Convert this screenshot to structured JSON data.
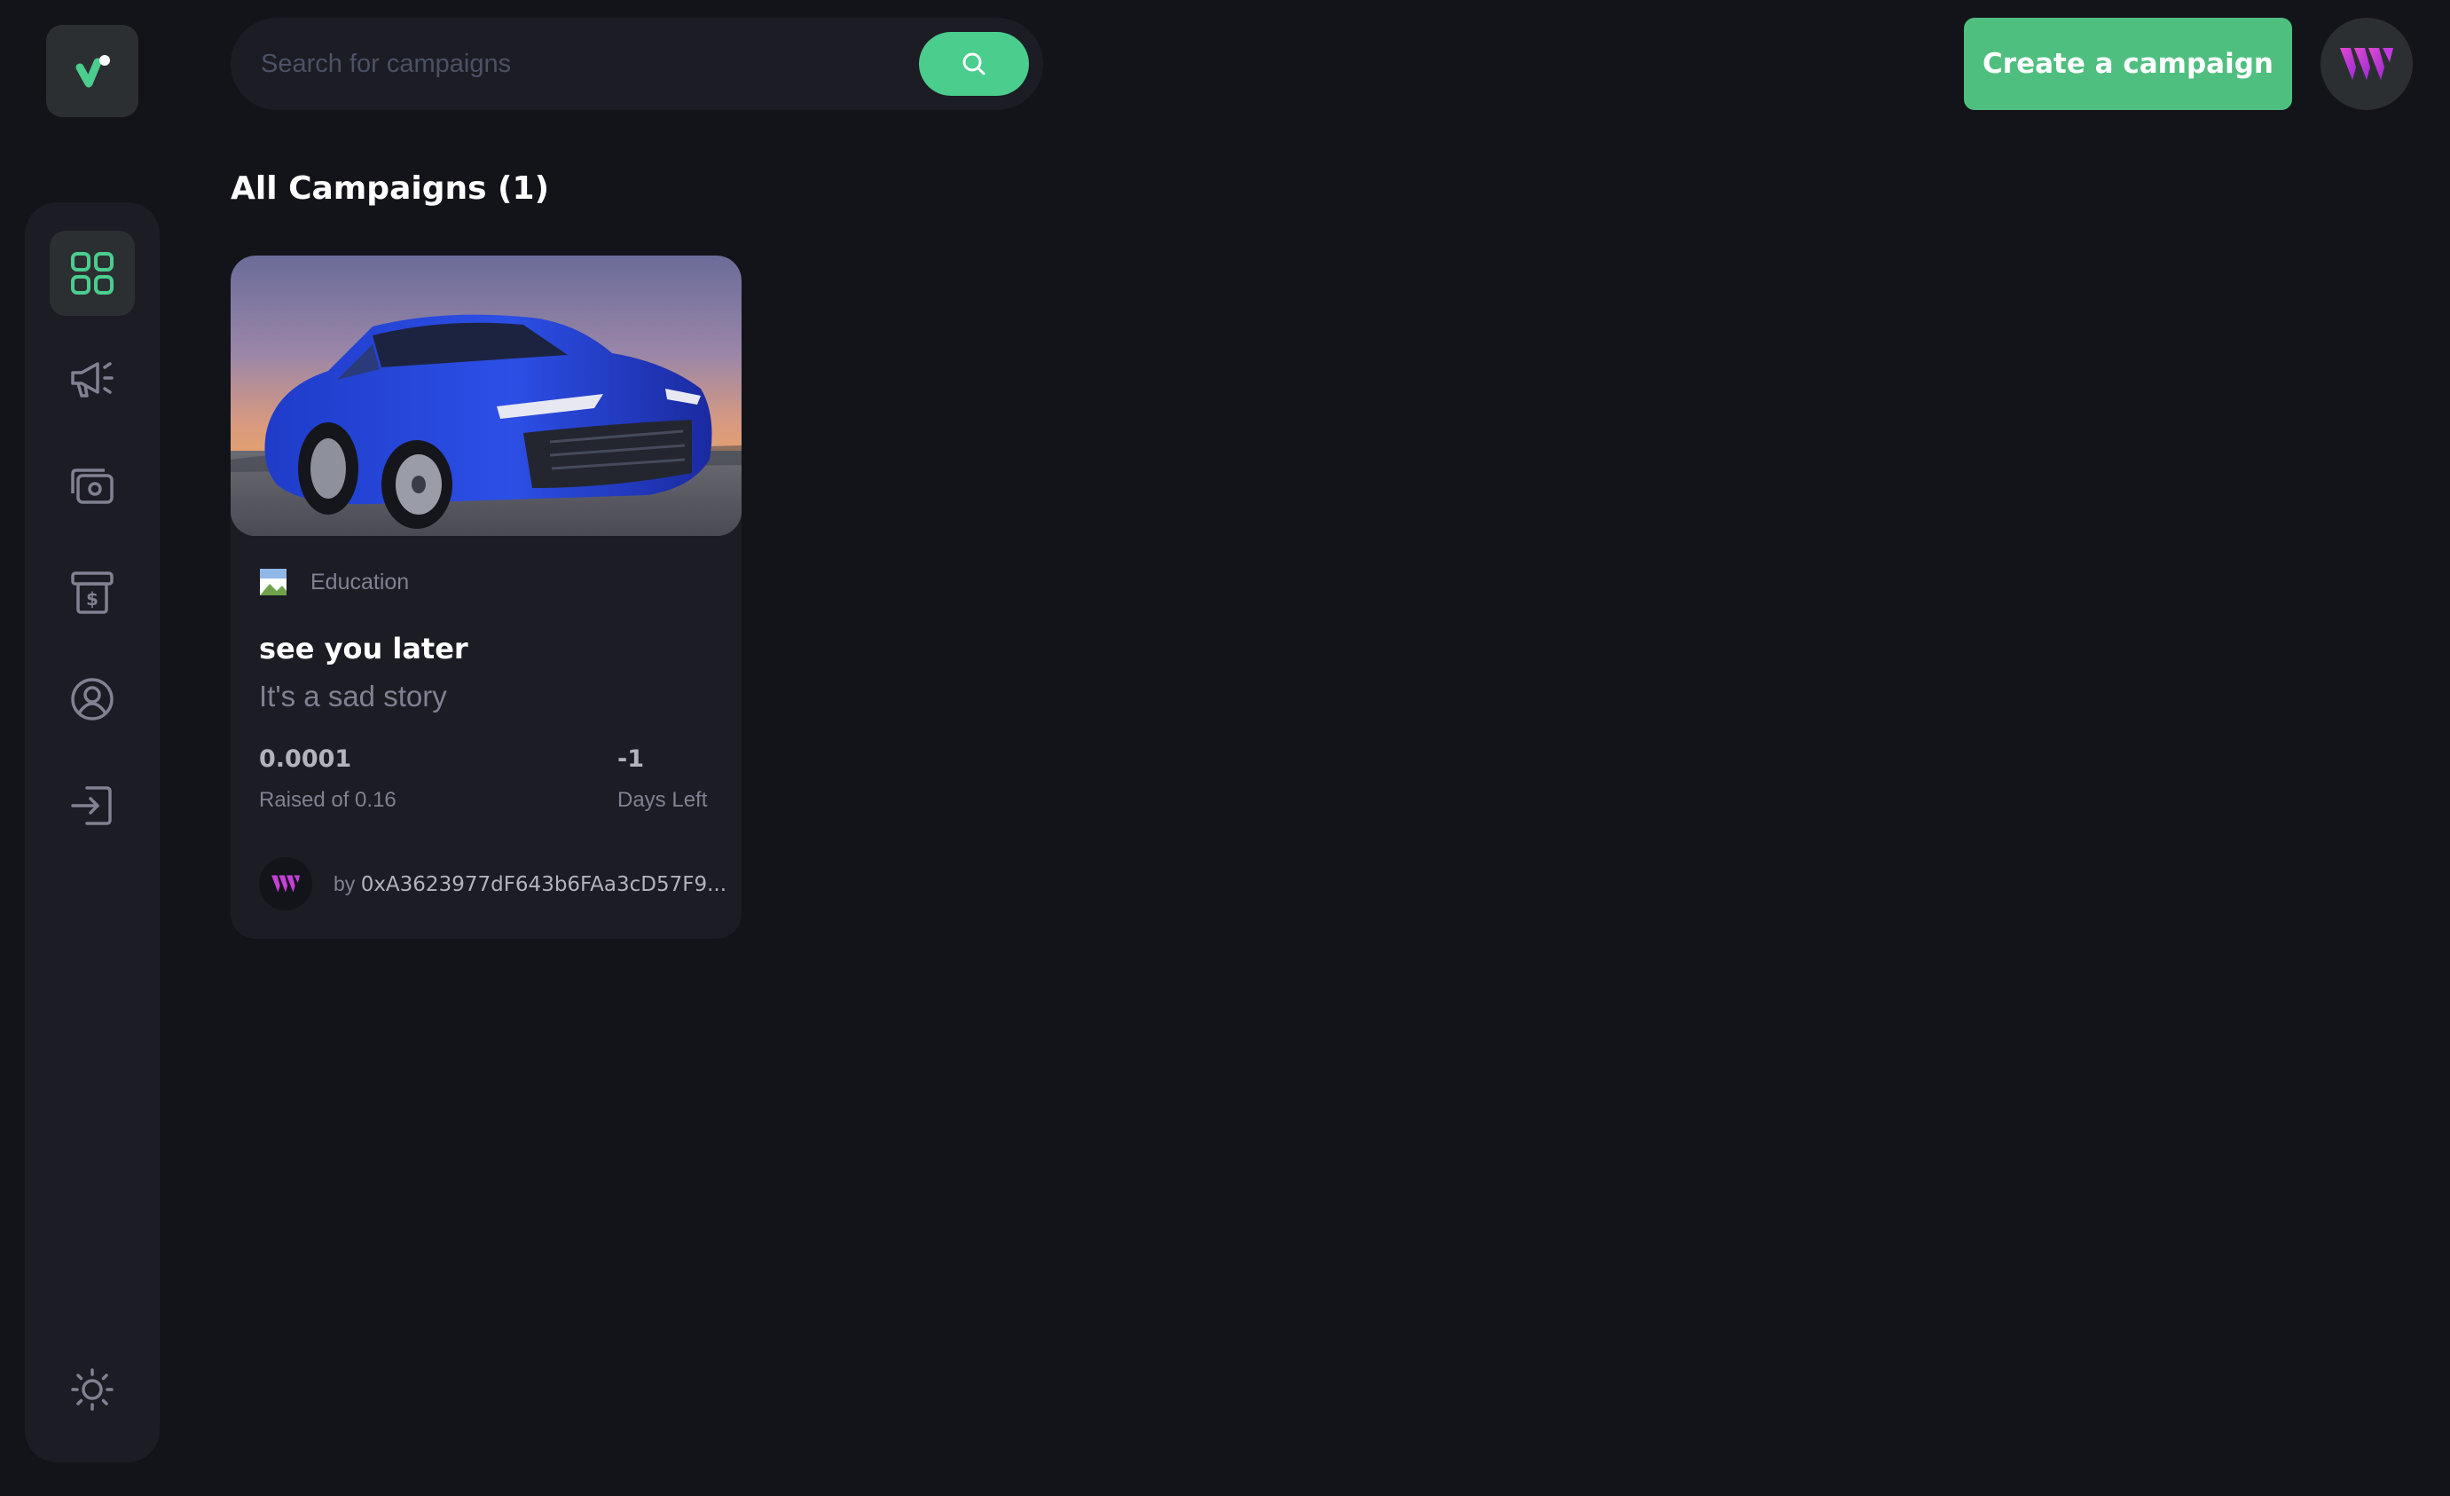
{
  "search": {
    "placeholder": "Search for campaigns"
  },
  "header": {
    "create_button_label": "Create a campaign"
  },
  "sidebar": {
    "items": [
      {
        "icon": "dashboard-icon",
        "active": true
      },
      {
        "icon": "megaphone-icon",
        "active": false
      },
      {
        "icon": "payment-icon",
        "active": false
      },
      {
        "icon": "withdraw-icon",
        "active": false
      },
      {
        "icon": "profile-icon",
        "active": false
      },
      {
        "icon": "logout-icon",
        "active": false
      }
    ],
    "theme_icon": "sun-icon"
  },
  "main": {
    "title": "All Campaigns (1)",
    "campaigns": [
      {
        "category": "Education",
        "title": "see you later",
        "description": "It's a sad story",
        "raised_value": "0.0001",
        "raised_label": "Raised of 0.16",
        "days_value": "-1",
        "days_label": "Days Left",
        "owner_prefix": "by",
        "owner": "0xA3623977dF643b6FAa3cD57F9..."
      }
    ]
  },
  "colors": {
    "accent": "#4acd8d",
    "background": "#13131a",
    "surface": "#1c1c24",
    "muted_text": "#808191"
  }
}
